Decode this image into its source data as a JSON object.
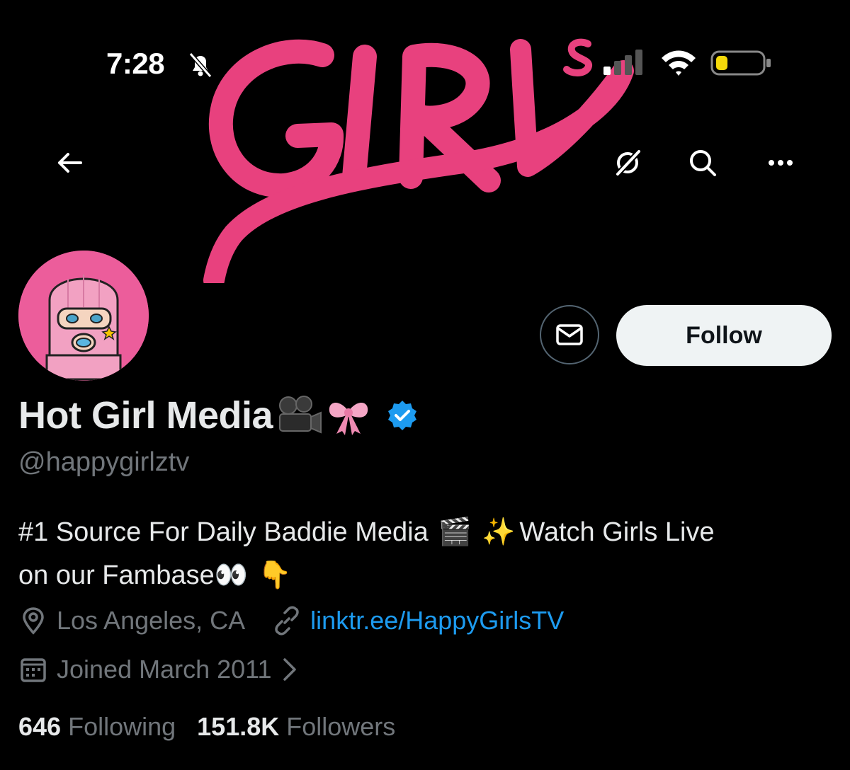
{
  "status_bar": {
    "time": "7:28"
  },
  "banner": {
    "logo_text": "GIRLs"
  },
  "nav": {
    "back_icon": "arrow-left-icon",
    "grok_icon": "grok-icon",
    "search_icon": "search-icon",
    "more_icon": "more-horizontal-icon"
  },
  "actions": {
    "message_icon": "mail-icon",
    "follow_label": "Follow"
  },
  "profile": {
    "display_name": "Hot Girl Media",
    "name_emojis": [
      "🎥",
      "🎀"
    ],
    "verified": true,
    "handle": "@happygirlztv",
    "bio_line1_text": "#1 Source For Daily Baddie Media",
    "bio_line1_emoji1": "🎬",
    "bio_line1_emoji2": "✨",
    "bio_line1_tail": "Watch Girls Live",
    "bio_line2_text": "on our Fambase",
    "bio_line2_emoji1": "👀",
    "bio_line2_emoji2": "👇",
    "location": "Los Angeles, CA",
    "website": "linktr.ee/HappyGirlsTV",
    "joined": "Joined March 2011"
  },
  "stats": {
    "following_count": "646",
    "following_label": "Following",
    "followers_count": "151.8K",
    "followers_label": "Followers"
  },
  "colors": {
    "background": "#000000",
    "accent_link": "#1d9bf0",
    "follow_bg": "#eff3f4",
    "brand_pink": "#e8417e",
    "muted_text": "#71767b"
  }
}
